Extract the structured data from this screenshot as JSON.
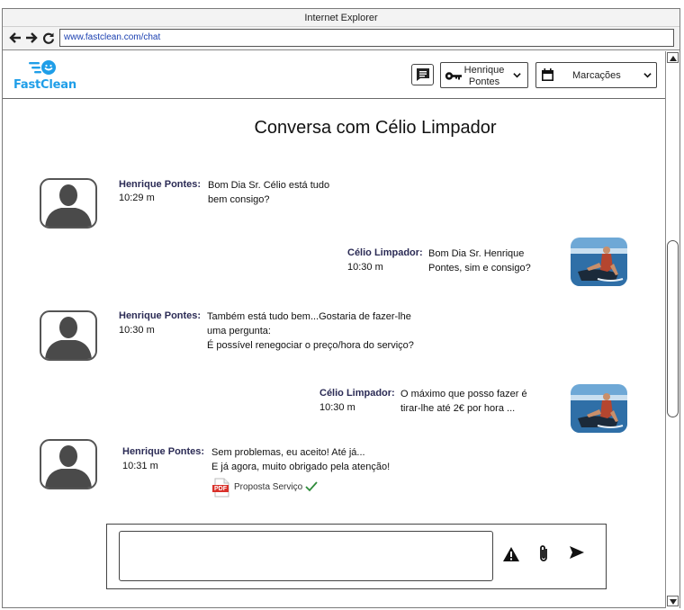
{
  "browser": {
    "title": "Internet Explorer",
    "url": "www.fastclean.com/chat"
  },
  "header": {
    "logo_text": "FastClean",
    "user_menu": {
      "line1": "Henrique",
      "line2": "Pontes"
    },
    "bookings_menu": {
      "label": "Marcações"
    }
  },
  "page": {
    "title": "Conversa com Célio Limpador"
  },
  "messages": [
    {
      "side": "left",
      "name": "Henrique Pontes:",
      "time": "10:29 m",
      "lines": [
        "Bom Dia Sr. Célio está tudo",
        "bem consigo?"
      ]
    },
    {
      "side": "right",
      "name": "Célio Limpador:",
      "time": "10:30 m",
      "lines": [
        "Bom Dia Sr. Henrique",
        "Pontes, sim e consigo?"
      ]
    },
    {
      "side": "left",
      "name": "Henrique Pontes:",
      "time": "10:30 m",
      "lines": [
        "Também está tudo bem...Gostaria de fazer-lhe",
        "uma pergunta:",
        "É possível renegociar o preço/hora do serviço?"
      ]
    },
    {
      "side": "right",
      "name": "Célio Limpador:",
      "time": "10:30 m",
      "lines": [
        "O máximo que posso fazer é",
        "tirar-lhe até 2€ por hora ..."
      ]
    },
    {
      "side": "left",
      "name": "Henrique Pontes:",
      "time": "10:31 m",
      "lines": [
        "Sem problemas, eu aceito! Até já...",
        "E já agora, muito obrigado pela atenção!"
      ]
    }
  ],
  "attachment": {
    "badge": "PDF",
    "label": "Proposta Serviço",
    "status_icon": "checkmark-icon"
  },
  "composer": {
    "placeholder": ""
  },
  "colors": {
    "brand": "#1f9ee8",
    "name_text": "#2b2b55",
    "pdf_red": "#d9302a",
    "check_green": "#2e8b3a"
  }
}
